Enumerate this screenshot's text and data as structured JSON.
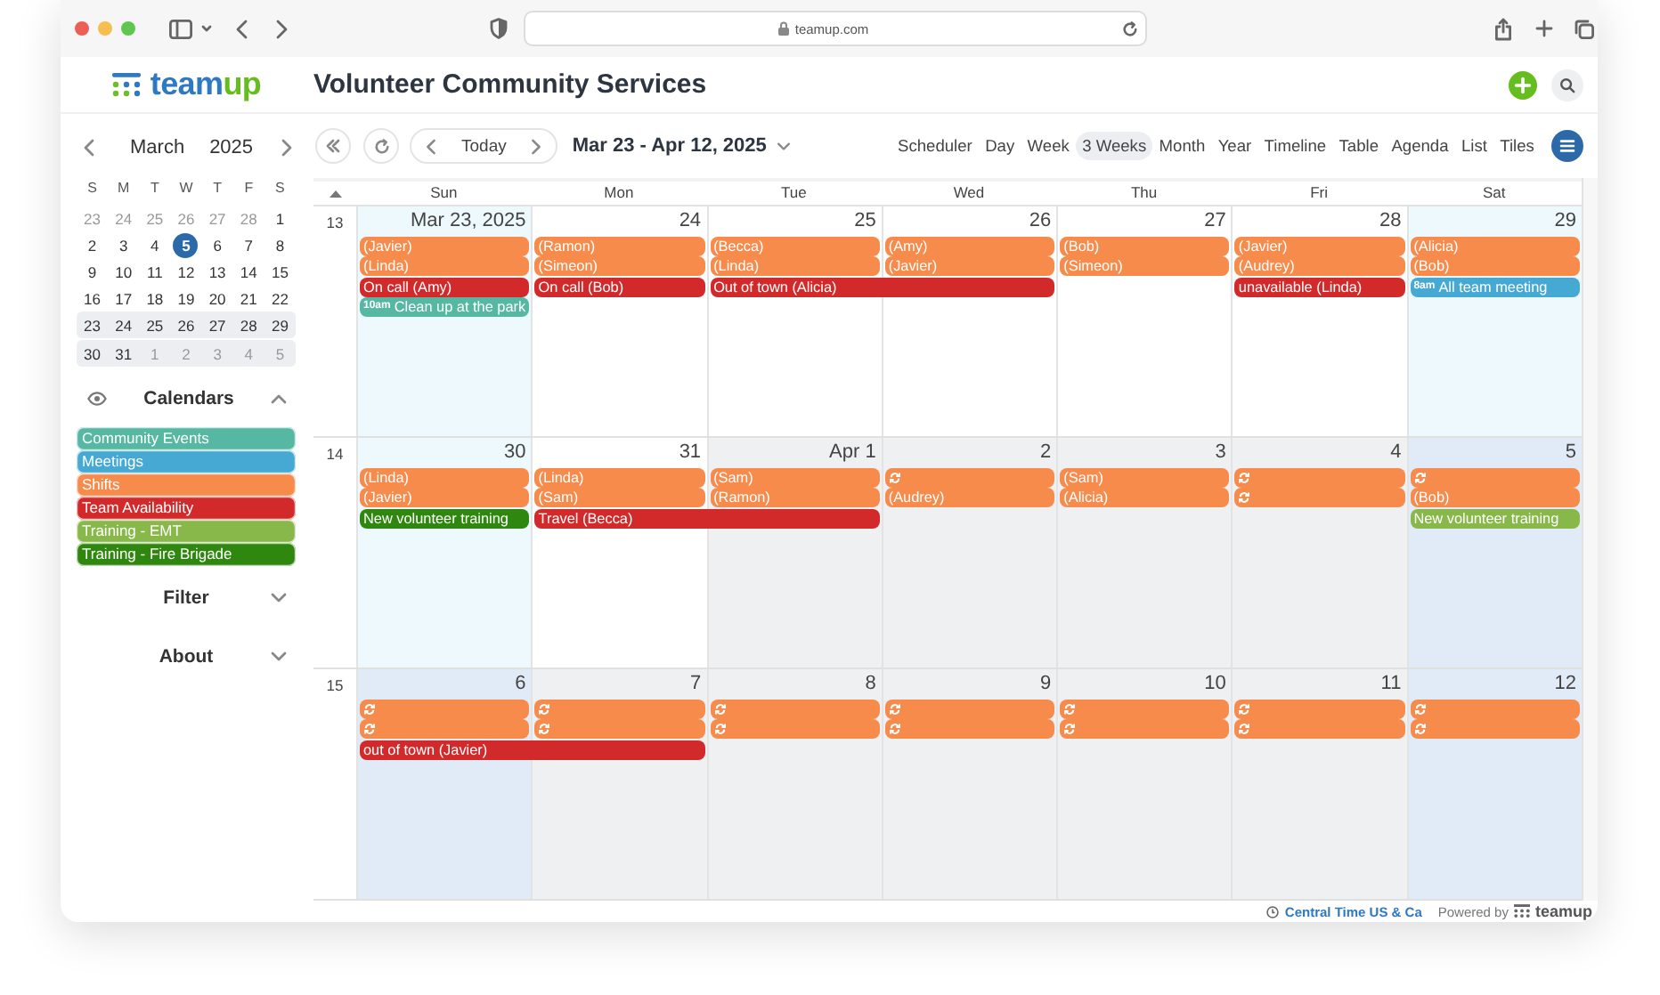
{
  "browser": {
    "url": "teamup.com"
  },
  "header": {
    "logo": {
      "primary": "team",
      "accent": "up"
    },
    "title": "Volunteer Community Services"
  },
  "sidebar": {
    "month": "March",
    "year": "2025",
    "weekdays": [
      "S",
      "M",
      "T",
      "W",
      "T",
      "F",
      "S"
    ],
    "weeks": [
      {
        "in_view": false,
        "days": [
          {
            "label": "23",
            "dim": true,
            "selected": false
          },
          {
            "label": "24",
            "dim": true,
            "selected": false
          },
          {
            "label": "25",
            "dim": true,
            "selected": false
          },
          {
            "label": "26",
            "dim": true,
            "selected": false
          },
          {
            "label": "27",
            "dim": true,
            "selected": false
          },
          {
            "label": "28",
            "dim": true,
            "selected": false
          },
          {
            "label": "1",
            "dim": false,
            "selected": false
          }
        ]
      },
      {
        "in_view": false,
        "days": [
          {
            "label": "2",
            "dim": false,
            "selected": false
          },
          {
            "label": "3",
            "dim": false,
            "selected": false
          },
          {
            "label": "4",
            "dim": false,
            "selected": false
          },
          {
            "label": "5",
            "dim": false,
            "selected": true
          },
          {
            "label": "6",
            "dim": false,
            "selected": false
          },
          {
            "label": "7",
            "dim": false,
            "selected": false
          },
          {
            "label": "8",
            "dim": false,
            "selected": false
          }
        ]
      },
      {
        "in_view": false,
        "days": [
          {
            "label": "9",
            "dim": false,
            "selected": false
          },
          {
            "label": "10",
            "dim": false,
            "selected": false
          },
          {
            "label": "11",
            "dim": false,
            "selected": false
          },
          {
            "label": "12",
            "dim": false,
            "selected": false
          },
          {
            "label": "13",
            "dim": false,
            "selected": false
          },
          {
            "label": "14",
            "dim": false,
            "selected": false
          },
          {
            "label": "15",
            "dim": false,
            "selected": false
          }
        ]
      },
      {
        "in_view": false,
        "days": [
          {
            "label": "16",
            "dim": false,
            "selected": false
          },
          {
            "label": "17",
            "dim": false,
            "selected": false
          },
          {
            "label": "18",
            "dim": false,
            "selected": false
          },
          {
            "label": "19",
            "dim": false,
            "selected": false
          },
          {
            "label": "20",
            "dim": false,
            "selected": false
          },
          {
            "label": "21",
            "dim": false,
            "selected": false
          },
          {
            "label": "22",
            "dim": false,
            "selected": false
          }
        ]
      },
      {
        "in_view": true,
        "days": [
          {
            "label": "23",
            "dim": false,
            "selected": false
          },
          {
            "label": "24",
            "dim": false,
            "selected": false
          },
          {
            "label": "25",
            "dim": false,
            "selected": false
          },
          {
            "label": "26",
            "dim": false,
            "selected": false
          },
          {
            "label": "27",
            "dim": false,
            "selected": false
          },
          {
            "label": "28",
            "dim": false,
            "selected": false
          },
          {
            "label": "29",
            "dim": false,
            "selected": false
          }
        ]
      },
      {
        "in_view": true,
        "days": [
          {
            "label": "30",
            "dim": false,
            "selected": false
          },
          {
            "label": "31",
            "dim": false,
            "selected": false
          },
          {
            "label": "1",
            "dim": true,
            "selected": false
          },
          {
            "label": "2",
            "dim": true,
            "selected": false
          },
          {
            "label": "3",
            "dim": true,
            "selected": false
          },
          {
            "label": "4",
            "dim": true,
            "selected": false
          },
          {
            "label": "5",
            "dim": true,
            "selected": false
          }
        ]
      }
    ],
    "calendars_title": "Calendars",
    "calendars": [
      {
        "name": "Community Events",
        "color": "#56b8a2"
      },
      {
        "name": "Meetings",
        "color": "#46a9d4"
      },
      {
        "name": "Shifts",
        "color": "#f68b4c"
      },
      {
        "name": "Team Availability",
        "color": "#d22a2a"
      },
      {
        "name": "Training - EMT",
        "color": "#88b84a"
      },
      {
        "name": "Training - Fire Brigade",
        "color": "#2f870f"
      }
    ],
    "sections": [
      {
        "title": "Filter",
        "expanded": false
      },
      {
        "title": "About",
        "expanded": false
      }
    ]
  },
  "toolbar": {
    "today": "Today",
    "range": "Mar 23 - Apr 12, 2025",
    "views": [
      {
        "label": "Scheduler",
        "selected": false
      },
      {
        "label": "Day",
        "selected": false
      },
      {
        "label": "Week",
        "selected": false
      },
      {
        "label": "3 Weeks",
        "selected": true
      },
      {
        "label": "Month",
        "selected": false
      },
      {
        "label": "Year",
        "selected": false
      },
      {
        "label": "Timeline",
        "selected": false
      },
      {
        "label": "Table",
        "selected": false
      },
      {
        "label": "Agenda",
        "selected": false
      },
      {
        "label": "List",
        "selected": false
      },
      {
        "label": "Tiles",
        "selected": false
      }
    ]
  },
  "grid": {
    "weekdays": [
      "Sun",
      "Mon",
      "Tue",
      "Wed",
      "Thu",
      "Fri",
      "Sat"
    ],
    "weeks": [
      {
        "number": "13",
        "days": [
          {
            "label": "Mar 23, 2025",
            "out_of_month": false
          },
          {
            "label": "24",
            "out_of_month": false
          },
          {
            "label": "25",
            "out_of_month": false
          },
          {
            "label": "26",
            "out_of_month": false
          },
          {
            "label": "27",
            "out_of_month": false
          },
          {
            "label": "28",
            "out_of_month": false
          },
          {
            "label": "29",
            "out_of_month": false
          }
        ],
        "lanes": [
          [
            {
              "kind": "event",
              "title": "(Javier)",
              "color": "#f68b4c",
              "recurring": false
            },
            {
              "kind": "event",
              "title": "(Ramon)",
              "color": "#f68b4c",
              "recurring": false
            },
            {
              "kind": "event",
              "title": "(Becca)",
              "color": "#f68b4c",
              "recurring": false
            },
            {
              "kind": "event",
              "title": "(Amy)",
              "color": "#f68b4c",
              "recurring": false
            },
            {
              "kind": "event",
              "title": "(Bob)",
              "color": "#f68b4c",
              "recurring": false
            },
            {
              "kind": "event",
              "title": "(Javier)",
              "color": "#f68b4c",
              "recurring": false
            },
            {
              "kind": "event",
              "title": "(Alicia)",
              "color": "#f68b4c",
              "recurring": false
            }
          ],
          [
            {
              "kind": "event",
              "title": "(Linda)",
              "color": "#f68b4c",
              "recurring": false
            },
            {
              "kind": "event",
              "title": "(Simeon)",
              "color": "#f68b4c",
              "recurring": false
            },
            {
              "kind": "event",
              "title": "(Linda)",
              "color": "#f68b4c",
              "recurring": false
            },
            {
              "kind": "event",
              "title": "(Javier)",
              "color": "#f68b4c",
              "recurring": false
            },
            {
              "kind": "event",
              "title": "(Simeon)",
              "color": "#f68b4c",
              "recurring": false
            },
            {
              "kind": "event",
              "title": "(Audrey)",
              "color": "#f68b4c",
              "recurring": false
            },
            {
              "kind": "event",
              "title": "(Bob)",
              "color": "#f68b4c",
              "recurring": false
            }
          ],
          [
            {
              "kind": "event",
              "title": "On call (Amy)",
              "color": "#d22a2a",
              "recurring": false
            },
            {
              "kind": "event",
              "title": "On call (Bob)",
              "color": "#d22a2a",
              "recurring": false
            },
            {
              "kind": "event",
              "title": "Out of town (Alicia)",
              "color": "#d22a2a",
              "recurring": false
            },
            {
              "kind": "continued"
            },
            {
              "kind": "empty"
            },
            {
              "kind": "event",
              "title": "unavailable (Linda)",
              "color": "#d22a2a",
              "recurring": false
            },
            {
              "kind": "event",
              "time": "8am",
              "title": "All team meeting",
              "color": "#46a9d4",
              "recurring": false
            }
          ],
          [
            {
              "kind": "event",
              "time": "10am",
              "title": "Clean up at the park",
              "color": "#56b8a2",
              "recurring": false
            },
            {
              "kind": "empty"
            },
            {
              "kind": "empty"
            },
            {
              "kind": "empty"
            },
            {
              "kind": "empty"
            },
            {
              "kind": "empty"
            },
            {
              "kind": "empty"
            }
          ]
        ]
      },
      {
        "number": "14",
        "days": [
          {
            "label": "30",
            "out_of_month": false
          },
          {
            "label": "31",
            "out_of_month": false
          },
          {
            "label": "Apr 1",
            "out_of_month": true
          },
          {
            "label": "2",
            "out_of_month": true
          },
          {
            "label": "3",
            "out_of_month": true
          },
          {
            "label": "4",
            "out_of_month": true
          },
          {
            "label": "5",
            "out_of_month": true
          }
        ],
        "lanes": [
          [
            {
              "kind": "event",
              "title": "(Linda)",
              "color": "#f68b4c",
              "recurring": false
            },
            {
              "kind": "event",
              "title": "(Linda)",
              "color": "#f68b4c",
              "recurring": false
            },
            {
              "kind": "event",
              "title": "(Sam)",
              "color": "#f68b4c",
              "recurring": false
            },
            {
              "kind": "event",
              "color": "#f68b4c",
              "recurring": true
            },
            {
              "kind": "event",
              "title": "(Sam)",
              "color": "#f68b4c",
              "recurring": false
            },
            {
              "kind": "event",
              "color": "#f68b4c",
              "recurring": true
            },
            {
              "kind": "event",
              "color": "#f68b4c",
              "recurring": true
            }
          ],
          [
            {
              "kind": "event",
              "title": "(Javier)",
              "color": "#f68b4c",
              "recurring": false
            },
            {
              "kind": "event",
              "title": "(Sam)",
              "color": "#f68b4c",
              "recurring": false
            },
            {
              "kind": "event",
              "title": "(Ramon)",
              "color": "#f68b4c",
              "recurring": false
            },
            {
              "kind": "event",
              "title": "(Audrey)",
              "color": "#f68b4c",
              "recurring": false
            },
            {
              "kind": "event",
              "title": "(Alicia)",
              "color": "#f68b4c",
              "recurring": false
            },
            {
              "kind": "event",
              "color": "#f68b4c",
              "recurring": true
            },
            {
              "kind": "event",
              "title": "(Bob)",
              "color": "#f68b4c",
              "recurring": false
            }
          ],
          [
            {
              "kind": "event",
              "title": "New volunteer training",
              "color": "#2f870f",
              "recurring": false
            },
            {
              "kind": "event",
              "title": "Travel (Becca)",
              "color": "#d22a2a",
              "recurring": false
            },
            {
              "kind": "continued"
            },
            {
              "kind": "empty"
            },
            {
              "kind": "empty"
            },
            {
              "kind": "empty"
            },
            {
              "kind": "event",
              "title": "New volunteer training",
              "color": "#88b84a",
              "recurring": false
            }
          ]
        ]
      },
      {
        "number": "15",
        "days": [
          {
            "label": "6",
            "out_of_month": true
          },
          {
            "label": "7",
            "out_of_month": true
          },
          {
            "label": "8",
            "out_of_month": true
          },
          {
            "label": "9",
            "out_of_month": true
          },
          {
            "label": "10",
            "out_of_month": true
          },
          {
            "label": "11",
            "out_of_month": true
          },
          {
            "label": "12",
            "out_of_month": true
          }
        ],
        "lanes": [
          [
            {
              "kind": "event",
              "color": "#f68b4c",
              "recurring": true
            },
            {
              "kind": "event",
              "color": "#f68b4c",
              "recurring": true
            },
            {
              "kind": "event",
              "color": "#f68b4c",
              "recurring": true
            },
            {
              "kind": "event",
              "color": "#f68b4c",
              "recurring": true
            },
            {
              "kind": "event",
              "color": "#f68b4c",
              "recurring": true
            },
            {
              "kind": "event",
              "color": "#f68b4c",
              "recurring": true
            },
            {
              "kind": "event",
              "color": "#f68b4c",
              "recurring": true
            }
          ],
          [
            {
              "kind": "event",
              "color": "#f68b4c",
              "recurring": true
            },
            {
              "kind": "event",
              "color": "#f68b4c",
              "recurring": true
            },
            {
              "kind": "event",
              "color": "#f68b4c",
              "recurring": true
            },
            {
              "kind": "event",
              "color": "#f68b4c",
              "recurring": true
            },
            {
              "kind": "event",
              "color": "#f68b4c",
              "recurring": true
            },
            {
              "kind": "event",
              "color": "#f68b4c",
              "recurring": true
            },
            {
              "kind": "event",
              "color": "#f68b4c",
              "recurring": true
            }
          ],
          [
            {
              "kind": "event",
              "title": "out of town (Javier)",
              "color": "#d22a2a",
              "recurring": false
            },
            {
              "kind": "continued"
            },
            {
              "kind": "empty"
            },
            {
              "kind": "empty"
            },
            {
              "kind": "empty"
            },
            {
              "kind": "empty"
            },
            {
              "kind": "empty"
            }
          ]
        ]
      }
    ]
  },
  "footer": {
    "timezone": "Central Time US & Ca",
    "powered_by": "Powered by",
    "brand": "teamup"
  }
}
